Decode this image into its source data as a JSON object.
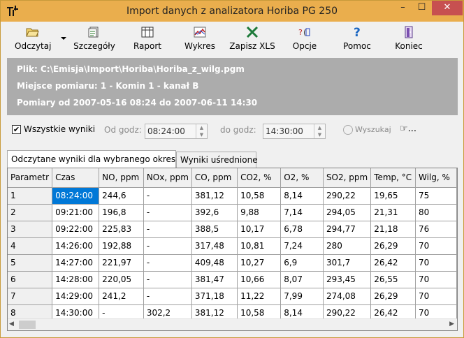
{
  "window": {
    "title": "Import danych z analizatora Horiba PG 250",
    "minimize": "–",
    "maximize": "☐",
    "close": "✕"
  },
  "toolbar": {
    "items": [
      {
        "label": "Odczytaj",
        "icon": "folder-open-icon"
      },
      {
        "label": "Szczegóły",
        "icon": "details-icon"
      },
      {
        "label": "Raport",
        "icon": "report-grid-icon"
      },
      {
        "label": "Wykres",
        "icon": "chart-icon"
      },
      {
        "label": "Zapisz XLS",
        "icon": "excel-icon"
      },
      {
        "label": "Opcje",
        "icon": "options-icon"
      },
      {
        "label": "Pomoc",
        "icon": "help-icon"
      },
      {
        "label": "Koniec",
        "icon": "exit-icon"
      }
    ]
  },
  "info": {
    "file": "Plik: C:\\Emisja\\Import\\Horiba\\Horiba_z_wilg.pgm",
    "location": "Miejsce pomiaru:   1 - Komin 1 - kanał B",
    "period": "Pomiary od 2007-05-16 08:24 do 2007-06-11 14:30"
  },
  "filter": {
    "all_results_label": "Wszystkie wyniki",
    "all_results_checked": "✔",
    "from_label": "Od godz:",
    "from_value": "08:24:00",
    "to_label": "do godz:",
    "to_value": "14:30:00",
    "search_label": "Wyszukaj",
    "more_label": "..."
  },
  "tabs": [
    {
      "label": "Odczytane wyniki dla wybranego okresu"
    },
    {
      "label": "Wyniki uśrednione"
    }
  ],
  "table": {
    "headers": [
      "Parametr",
      "Czas",
      "NO, ppm",
      "NOx, ppm",
      "CO, ppm",
      "CO2, %",
      "O2, %",
      "SO2, ppm",
      "Temp, °C",
      "Wilg,  %"
    ],
    "rows": [
      [
        "1",
        "08:24:00",
        "244,6",
        "-",
        "381,12",
        "10,58",
        "8,14",
        "290,22",
        "19,65",
        "75"
      ],
      [
        "2",
        "09:21:00",
        "196,8",
        "-",
        "392,6",
        "9,88",
        "7,14",
        "294,05",
        "21,31",
        "80"
      ],
      [
        "3",
        "09:22:00",
        "225,83",
        "-",
        "388,5",
        "10,17",
        "6,78",
        "294,77",
        "21,18",
        "76"
      ],
      [
        "4",
        "14:26:00",
        "192,88",
        "-",
        "317,48",
        "10,81",
        "7,24",
        "280",
        "26,29",
        "70"
      ],
      [
        "5",
        "14:27:00",
        "221,97",
        "-",
        "409,48",
        "10,27",
        "6,9",
        "301,7",
        "26,42",
        "70"
      ],
      [
        "6",
        "14:28:00",
        "220,05",
        "-",
        "381,47",
        "10,66",
        "8,07",
        "293,45",
        "26,55",
        "70"
      ],
      [
        "7",
        "14:29:00",
        "241,2",
        "-",
        "371,18",
        "11,22",
        "7,99",
        "274,08",
        "26,29",
        "70"
      ],
      [
        "8",
        "14:30:00",
        "-",
        "302,2",
        "381,12",
        "10,58",
        "8,14",
        "290,22",
        "26,42",
        "70"
      ]
    ]
  }
}
